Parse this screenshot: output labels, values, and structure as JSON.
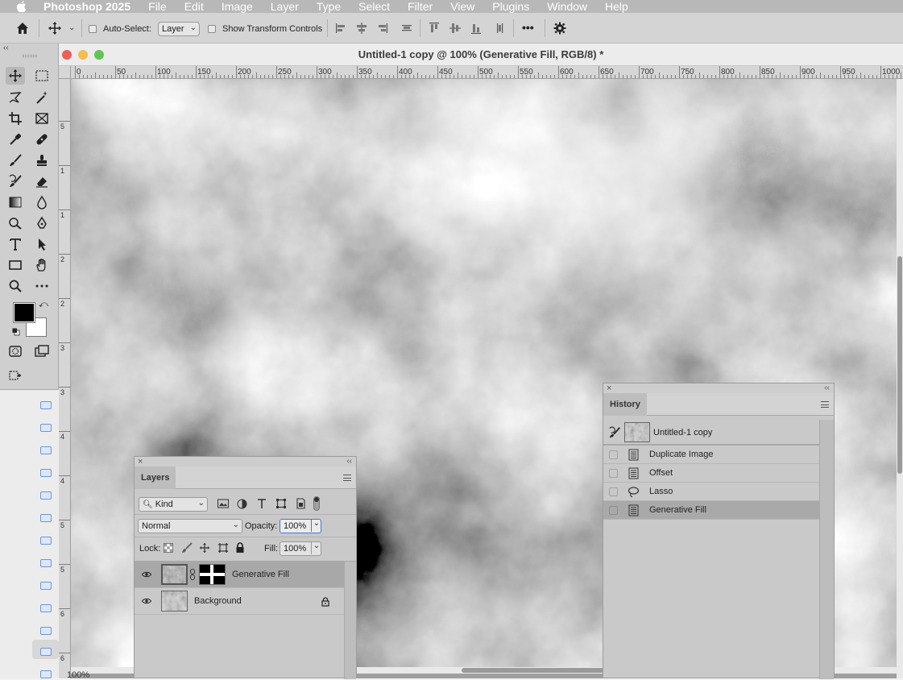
{
  "menubar": {
    "app": "Photoshop 2025",
    "items": [
      "File",
      "Edit",
      "Image",
      "Layer",
      "Type",
      "Select",
      "Filter",
      "View",
      "Plugins",
      "Window",
      "Help"
    ]
  },
  "options_bar": {
    "auto_select_label": "Auto-Select:",
    "auto_select_value": "Layer",
    "show_transform_label": "Show Transform Controls",
    "more_label": "•••"
  },
  "document": {
    "title": "Untitled-1 copy @ 100% (Generative Fill, RGB/8) *",
    "zoom": "100%",
    "ruler_h": [
      "0",
      "50",
      "100",
      "150",
      "200",
      "250",
      "300",
      "350",
      "400",
      "450",
      "500",
      "550",
      "600",
      "650",
      "700",
      "750",
      "800",
      "850",
      "900",
      "950",
      "1000"
    ],
    "ruler_v": [
      "5",
      "1",
      "1",
      "2",
      "2",
      "3",
      "3",
      "4",
      "4",
      "5",
      "5",
      "6",
      "6"
    ]
  },
  "layers_panel": {
    "tab": "Layers",
    "filter_kind": "Kind",
    "blend_mode": "Normal",
    "opacity_label": "Opacity:",
    "opacity_value": "100%",
    "lock_label": "Lock:",
    "fill_label": "Fill:",
    "fill_value": "100%",
    "layers": [
      {
        "name": "Generative Fill",
        "selected": true,
        "visible": true
      },
      {
        "name": "Background",
        "selected": false,
        "visible": true,
        "locked": true
      }
    ]
  },
  "history_panel": {
    "tab": "History",
    "snapshot": "Untitled-1 copy",
    "steps": [
      "Duplicate Image",
      "Offset",
      "Lasso",
      "Generative Fill"
    ],
    "selected_step": "Generative Fill"
  },
  "colors": {
    "foreground": "#000000",
    "background": "#ffffff",
    "close": "#ec5f57",
    "minimize": "#f4bd4f",
    "maximize": "#61c554"
  }
}
